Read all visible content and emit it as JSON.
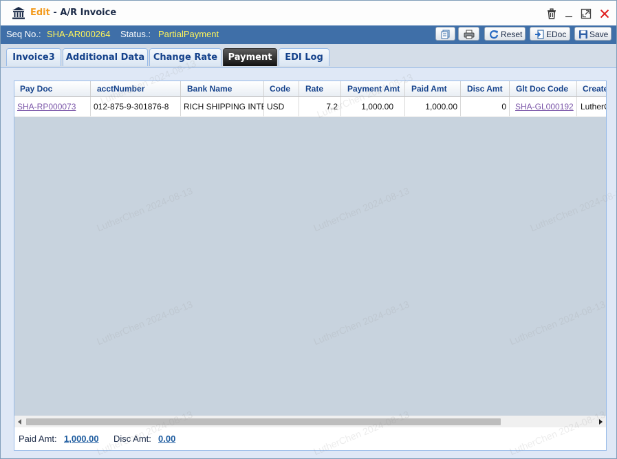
{
  "window": {
    "mode_label": "Edit",
    "separator": " - ",
    "title": "A/R Invoice",
    "icons": [
      "bank-icon",
      "delete-icon",
      "minimize-icon",
      "maximize-icon",
      "close-icon"
    ]
  },
  "info": {
    "seq_label": "Seq No.:",
    "seq_value": "SHA-AR000264",
    "status_label": "Status.:",
    "status_value": "PartialPayment"
  },
  "toolbar": {
    "reset_label": "Reset",
    "edoc_label": "EDoc",
    "save_label": "Save"
  },
  "tabs": [
    {
      "label": "Invoice3"
    },
    {
      "label": "Additional Data"
    },
    {
      "label": "Change Rate"
    },
    {
      "label": "Payment",
      "active": true
    },
    {
      "label": "EDI Log"
    }
  ],
  "grid": {
    "columns": [
      "Pay Doc",
      "acctNumber",
      "Bank Name",
      "Code",
      "Rate",
      "Payment Amt",
      "Paid Amt",
      "Disc Amt",
      "Glt Doc Code",
      "Create"
    ],
    "rows": [
      [
        "SHA-RP000073",
        "012-875-9-301876-8",
        "RICH SHIPPING INTE",
        "USD",
        "7.2",
        "1,000.00",
        "1,000.00",
        "0",
        "SHA-GL000192",
        "LutherC"
      ]
    ]
  },
  "footer": {
    "paid_label": "Paid Amt:",
    "paid_value": "1,000.00",
    "disc_label": "Disc Amt:",
    "disc_value": "0.00"
  },
  "watermark": "LutherChen 2024-08-13",
  "colors": {
    "info_bar": "#3f6fa8",
    "status_value": "#fff55a",
    "edit_label": "#f39a1d",
    "link": "#7a55a8",
    "close_icon": "#e02020"
  }
}
